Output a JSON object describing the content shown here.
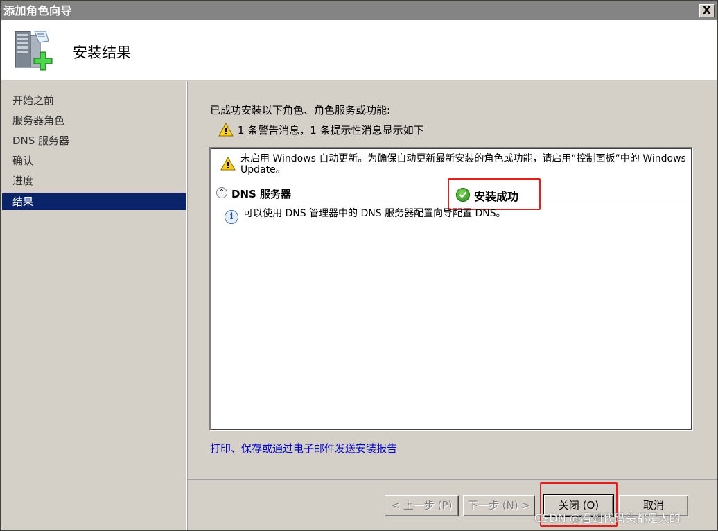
{
  "window": {
    "title": "添加角色向导",
    "close_glyph": "X"
  },
  "header": {
    "title": "安装结果",
    "icon": "server-add-icon"
  },
  "sidebar": {
    "items": [
      {
        "label": "开始之前",
        "active": false
      },
      {
        "label": "服务器角色",
        "active": false
      },
      {
        "label": "DNS 服务器",
        "active": false
      },
      {
        "label": "确认",
        "active": false
      },
      {
        "label": "进度",
        "active": false
      },
      {
        "label": "结果",
        "active": true
      }
    ]
  },
  "main": {
    "intro": "已成功安装以下角色、角色服务或功能:",
    "summary": "1 条警告消息，1 条提示性消息显示如下",
    "results": {
      "warning": "未启用 Windows 自动更新。为确保自动更新最新安装的角色或功能，请启用“控制面板”中的 Windows Update。",
      "role_name": "DNS 服务器",
      "collapse_glyph": "⌃",
      "status": "安装成功",
      "info": "可以使用 DNS 管理器中的 DNS 服务器配置向导配置 DNS。"
    },
    "report_link": "打印、保存或通过电子邮件发送安装报告"
  },
  "footer": {
    "prev": "< 上一步 (P)",
    "next": "下一步 (N) >",
    "close": "关闭 (O)",
    "cancel": "取消"
  },
  "watermark": "CSDN @看到代码头都是大的",
  "colors": {
    "accent": "#0a246a",
    "title_bar": "#848484",
    "highlight": "#e02020",
    "link": "#0000cc"
  }
}
